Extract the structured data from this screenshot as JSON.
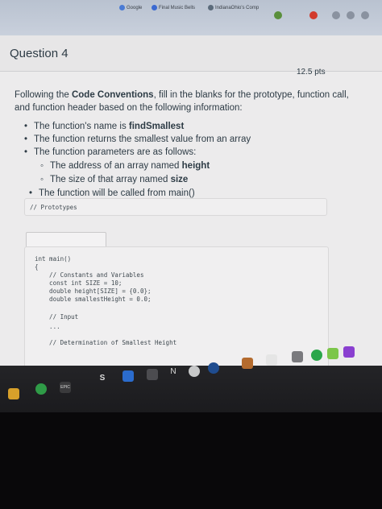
{
  "bookmarks": {
    "items": [
      "Google",
      "Final Music Bells",
      "IndianaOhio's Comp"
    ]
  },
  "question": {
    "title": "Question 4",
    "points": "12.5 pts",
    "prompt_pre": "Following the ",
    "prompt_bold": "Code Conventions",
    "prompt_post": ", fill in the blanks for the prototype, function call, and function header based on the following information:",
    "b1_pre": "The function's name is ",
    "b1_bold": "findSmallest",
    "b2": "The function returns the smallest value from an array",
    "b3": "The function parameters are as follows:",
    "s1_pre": "The address of an array named ",
    "s1_bold": "height",
    "s2_pre": "The size of that array named ",
    "s2_bold": "size",
    "b4": "The function will be called from main()"
  },
  "code": {
    "prototypes_comment": "// Prototypes",
    "main_lines": [
      "int main()",
      "{",
      "    // Constants and Variables",
      "    const int SIZE = 10;",
      "    double height[SIZE] = {0.0};",
      "    double smallestHeight = 0.0;",
      "",
      "    // Input",
      "    ...",
      "",
      "    // Determination of Smallest Height"
    ]
  },
  "taskbar": {
    "epic_label": "EPIC",
    "s_label": "S",
    "n_label": "N"
  }
}
